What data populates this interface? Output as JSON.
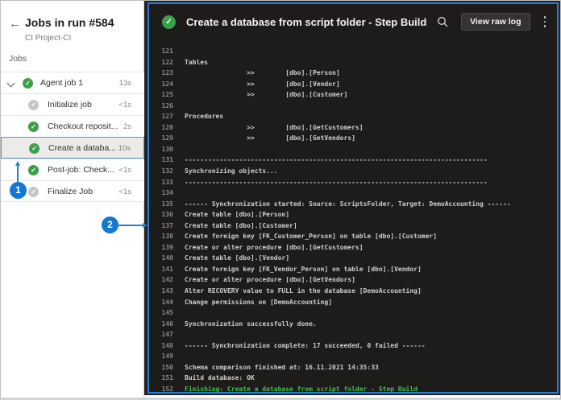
{
  "sidebar": {
    "back_icon": "←",
    "title": "Jobs in run #584",
    "subtitle": "CI Project-CI",
    "section_label": "Jobs",
    "items": [
      {
        "label": "Agent job 1",
        "time": "13s",
        "status": "success",
        "type": "parent",
        "selected": false
      },
      {
        "label": "Initialize job",
        "time": "<1s",
        "status": "skipped",
        "type": "child",
        "selected": false
      },
      {
        "label": "Checkout reposit...",
        "time": "2s",
        "status": "success",
        "type": "child",
        "selected": false
      },
      {
        "label": "Create a databa...",
        "time": "10s",
        "status": "success",
        "type": "child",
        "selected": true
      },
      {
        "label": "Post-job: Check...",
        "time": "<1s",
        "status": "success",
        "type": "child",
        "selected": false
      },
      {
        "label": "Finalize Job",
        "time": "<1s",
        "status": "skipped",
        "type": "child",
        "selected": false
      }
    ],
    "status_check_glyph": "✓"
  },
  "log_panel": {
    "status_check_glyph": "✓",
    "title": "Create a database from script folder - Step Build",
    "search_icon": "magnifier",
    "view_raw_log_label": "View raw log",
    "more_icon": "vertical-ellipsis",
    "colors": {
      "border": "#2b7cd3",
      "background": "#1d1c1b",
      "text": "#d0cecb",
      "highlight_text": "#43c043",
      "line_number": "#8a8886"
    },
    "lines": [
      {
        "num": 121,
        "text": ""
      },
      {
        "num": 122,
        "text": "Tables"
      },
      {
        "num": 123,
        "text": "                >>        [dbo].[Person]"
      },
      {
        "num": 124,
        "text": "                >>        [dbo].[Vendor]"
      },
      {
        "num": 125,
        "text": "                >>        [dbo].[Customer]"
      },
      {
        "num": 126,
        "text": ""
      },
      {
        "num": 127,
        "text": "Procedures"
      },
      {
        "num": 128,
        "text": "                >>        [dbo].[GetCustomers]"
      },
      {
        "num": 129,
        "text": "                >>        [dbo].[GetVendors]"
      },
      {
        "num": 130,
        "text": ""
      },
      {
        "num": 131,
        "text": "------------------------------------------------------------------------------"
      },
      {
        "num": 132,
        "text": "Synchronizing objects..."
      },
      {
        "num": 133,
        "text": "------------------------------------------------------------------------------"
      },
      {
        "num": 134,
        "text": ""
      },
      {
        "num": 135,
        "text": "------ Synchronization started: Source: ScriptsFolder, Target: DemoAccounting ------"
      },
      {
        "num": 136,
        "text": "Create table [dbo].[Person]"
      },
      {
        "num": 137,
        "text": "Create table [dbo].[Customer]"
      },
      {
        "num": 138,
        "text": "Create foreign key [FK_Customer_Person] on table [dbo].[Customer]"
      },
      {
        "num": 139,
        "text": "Create or alter procedure [dbo].[GetCustomers]"
      },
      {
        "num": 140,
        "text": "Create table [dbo].[Vendor]"
      },
      {
        "num": 141,
        "text": "Create foreign key [FK_Vendor_Person] on table [dbo].[Vendor]"
      },
      {
        "num": 142,
        "text": "Create or alter procedure [dbo].[GetVendors]"
      },
      {
        "num": 143,
        "text": "Alter RECOVERY value to FULL in the database [DemoAccounting]"
      },
      {
        "num": 144,
        "text": "Change permissions on [DemoAccounting]"
      },
      {
        "num": 145,
        "text": ""
      },
      {
        "num": 146,
        "text": "Synchronization successfully done."
      },
      {
        "num": 147,
        "text": ""
      },
      {
        "num": 148,
        "text": "------ Synchronization complete: 17 succeeded, 0 failed ------"
      },
      {
        "num": 149,
        "text": ""
      },
      {
        "num": 150,
        "text": "Schema comparison finished at: 16.11.2021 14:35:33"
      },
      {
        "num": 151,
        "text": "Build database: OK"
      },
      {
        "num": 152,
        "text": "Finishing: Create a database from script folder - Step Build",
        "highlight": true
      }
    ]
  },
  "annotations": [
    {
      "label": "1"
    },
    {
      "label": "2"
    }
  ],
  "colors": {
    "success_green": "#3ba04a",
    "skipped_gray": "#c8c6c4",
    "selected_border_blue": "#5596d4",
    "selected_bg": "#edebe9",
    "annotation_blue": "#1177d1"
  }
}
